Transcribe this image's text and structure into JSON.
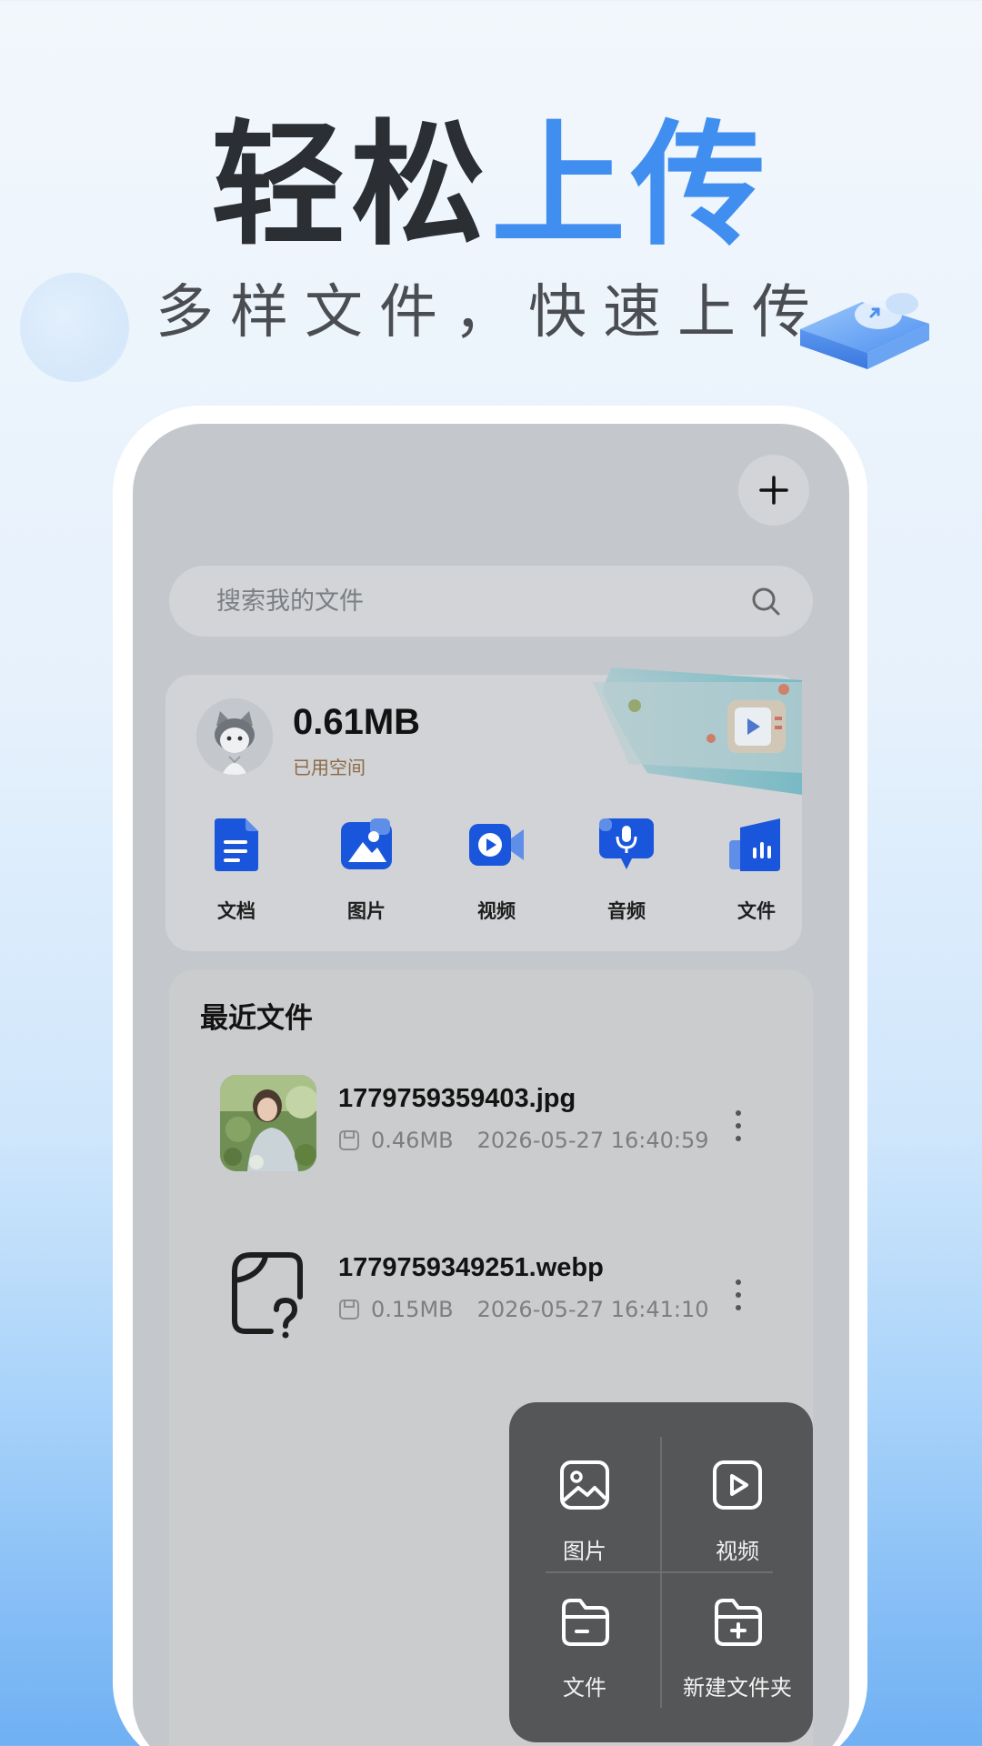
{
  "promo": {
    "headline_dark": "轻松",
    "headline_blue": "上传",
    "subline": "多样文件，快速上传"
  },
  "toolbar": {
    "add_icon": "plus-icon"
  },
  "search": {
    "placeholder": "搜索我的文件",
    "icon": "search-icon"
  },
  "storage": {
    "used": "0.61MB",
    "used_label": "已用空间"
  },
  "categories": [
    {
      "label": "文档",
      "icon": "document-icon"
    },
    {
      "label": "图片",
      "icon": "image-icon"
    },
    {
      "label": "视频",
      "icon": "video-icon"
    },
    {
      "label": "音频",
      "icon": "microphone-icon"
    },
    {
      "label": "文件",
      "icon": "chart-file-icon"
    }
  ],
  "recent": {
    "title": "最近文件",
    "files": [
      {
        "name": "1779759359403.jpg",
        "size": "0.46MB",
        "time": "2026-05-27 16:40:59",
        "thumb": "photo"
      },
      {
        "name": "1779759349251.webp",
        "size": "0.15MB",
        "time": "2026-05-27 16:41:10",
        "thumb": "unknown-file-icon"
      }
    ]
  },
  "popup": {
    "items": [
      {
        "label": "图片",
        "icon": "image-icon"
      },
      {
        "label": "视频",
        "icon": "video-play-icon"
      },
      {
        "label": "文件",
        "icon": "folder-icon"
      },
      {
        "label": "新建文件夹",
        "icon": "new-folder-icon"
      }
    ]
  },
  "colors": {
    "accent": "#3f8ef0",
    "category_blue": "#1a56db",
    "popup_bg": "#555657"
  }
}
